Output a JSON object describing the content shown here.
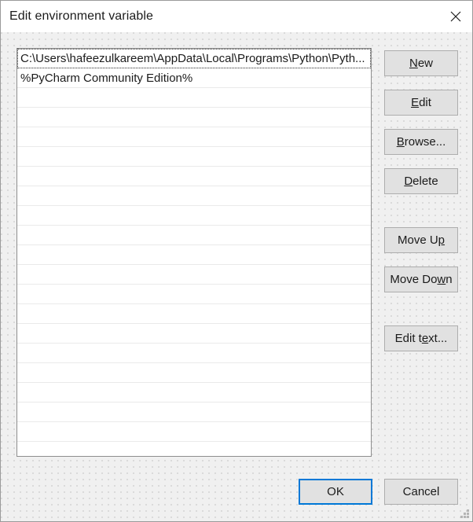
{
  "window": {
    "title": "Edit environment variable",
    "close_icon": "close-icon",
    "resize_grip_icon": "resize-grip-icon"
  },
  "list": {
    "rows": [
      {
        "text": "C:\\Users\\hafeezulkareem\\AppData\\Local\\Programs\\Python\\Pyth...",
        "focused": true
      },
      {
        "text": "%PyCharm Community Edition%",
        "focused": false
      },
      {
        "text": "",
        "focused": false
      },
      {
        "text": "",
        "focused": false
      },
      {
        "text": "",
        "focused": false
      },
      {
        "text": "",
        "focused": false
      },
      {
        "text": "",
        "focused": false
      },
      {
        "text": "",
        "focused": false
      },
      {
        "text": "",
        "focused": false
      },
      {
        "text": "",
        "focused": false
      },
      {
        "text": "",
        "focused": false
      },
      {
        "text": "",
        "focused": false
      },
      {
        "text": "",
        "focused": false
      },
      {
        "text": "",
        "focused": false
      },
      {
        "text": "",
        "focused": false
      },
      {
        "text": "",
        "focused": false
      },
      {
        "text": "",
        "focused": false
      },
      {
        "text": "",
        "focused": false
      },
      {
        "text": "",
        "focused": false
      },
      {
        "text": "",
        "focused": false
      },
      {
        "text": "",
        "focused": false
      }
    ]
  },
  "side_buttons": {
    "new": {
      "pre": "",
      "acc": "N",
      "post": "ew"
    },
    "edit": {
      "pre": "",
      "acc": "E",
      "post": "dit"
    },
    "browse": {
      "pre": "",
      "acc": "B",
      "post": "rowse..."
    },
    "delete": {
      "pre": "",
      "acc": "D",
      "post": "elete"
    },
    "move_up": {
      "pre": "Move U",
      "acc": "p",
      "post": ""
    },
    "move_down": {
      "pre": "Move Do",
      "acc": "w",
      "post": "n"
    },
    "edit_text": {
      "pre": "Edit t",
      "acc": "e",
      "post": "xt..."
    }
  },
  "bottom_buttons": {
    "ok": "OK",
    "cancel": "Cancel"
  },
  "colors": {
    "titlebar_bg": "#ffffff",
    "dialog_bg": "#f0f0f0",
    "button_bg": "#e1e1e1",
    "button_border": "#adadad",
    "focus_accent": "#0078d7",
    "list_bg": "#ffffff",
    "list_border": "#8d8d8d",
    "text": "#1b1b1b"
  }
}
